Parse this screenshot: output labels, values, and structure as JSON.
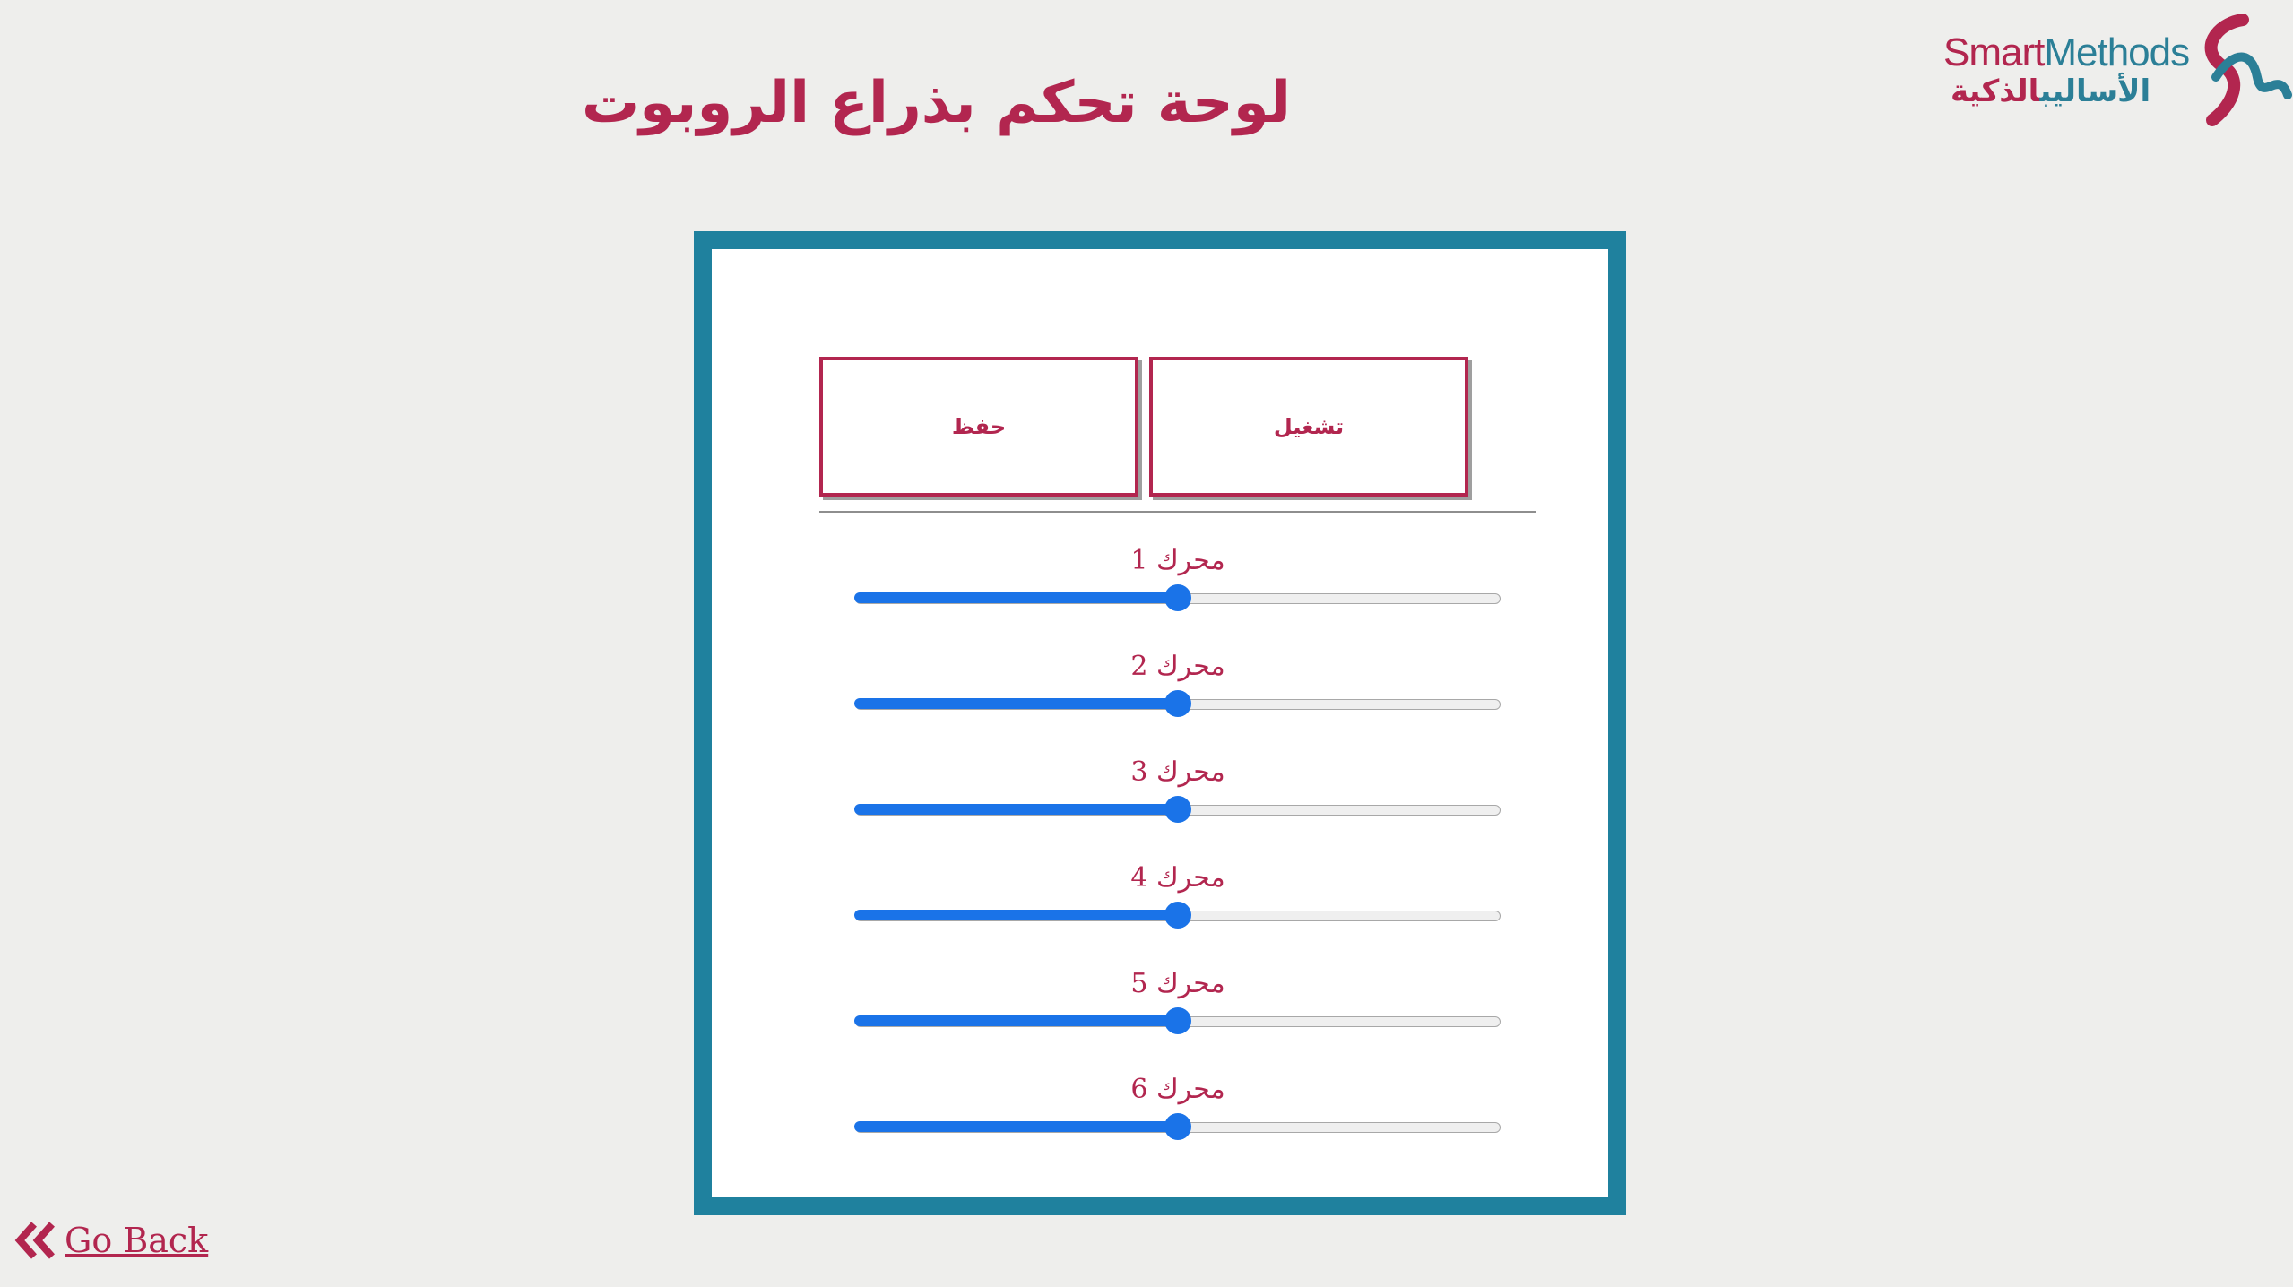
{
  "logo": {
    "en_part1": "Smart",
    "en_part2": "Methods",
    "ar_part1": "الأساليب",
    "ar_part2": "الذكية"
  },
  "title": "لوحة تحكم بذراع الروبوت",
  "buttons": {
    "save": "حفظ",
    "run": "تشغيل"
  },
  "motors": [
    {
      "label": "محرك 1",
      "value": 90,
      "min": 0,
      "max": 180
    },
    {
      "label": "محرك 2",
      "value": 90,
      "min": 0,
      "max": 180
    },
    {
      "label": "محرك 3",
      "value": 90,
      "min": 0,
      "max": 180
    },
    {
      "label": "محرك 4",
      "value": 90,
      "min": 0,
      "max": 180
    },
    {
      "label": "محرك 5",
      "value": 90,
      "min": 0,
      "max": 180
    },
    {
      "label": "محرك 6",
      "value": 90,
      "min": 0,
      "max": 180
    }
  ],
  "go_back": "Go Back",
  "colors": {
    "brand": "#b2264f",
    "frame": "#1f819e",
    "slider": "#1a73e8",
    "background": "#eeeeec"
  }
}
